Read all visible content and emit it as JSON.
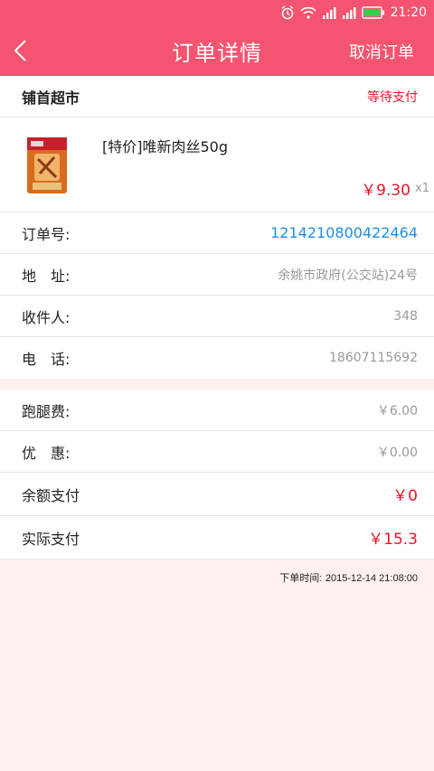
{
  "status_bar": {
    "time": "21:20"
  },
  "header": {
    "title": "订单详情",
    "cancel_label": "取消订单"
  },
  "store": {
    "name": "铺首超市",
    "status": "等待支付"
  },
  "product": {
    "name": "[特价]唯新肉丝50g",
    "price": "￥9.30",
    "qty": "x1"
  },
  "details": [
    {
      "label": "订单号:",
      "value": "1214210800422464"
    },
    {
      "label": "地　址:",
      "value": "余姚市政府(公交站)24号"
    },
    {
      "label": "收件人:",
      "value": "348"
    },
    {
      "label": "电　话:",
      "value": "18607115692"
    }
  ],
  "fees": [
    {
      "label": "跑腿费:",
      "value": "￥6.00"
    },
    {
      "label": "优　惠:",
      "value": "￥0.00"
    },
    {
      "label": "余额支付",
      "value": "￥0"
    },
    {
      "label": "实际支付",
      "value": "￥15.3"
    }
  ],
  "order_time": {
    "label": "下单时间:",
    "value": "2015-12-14 21:08:00"
  },
  "colors": {
    "accent": "#f4546f",
    "price_red": "#e8132b",
    "link_blue": "#1e8ee0"
  }
}
